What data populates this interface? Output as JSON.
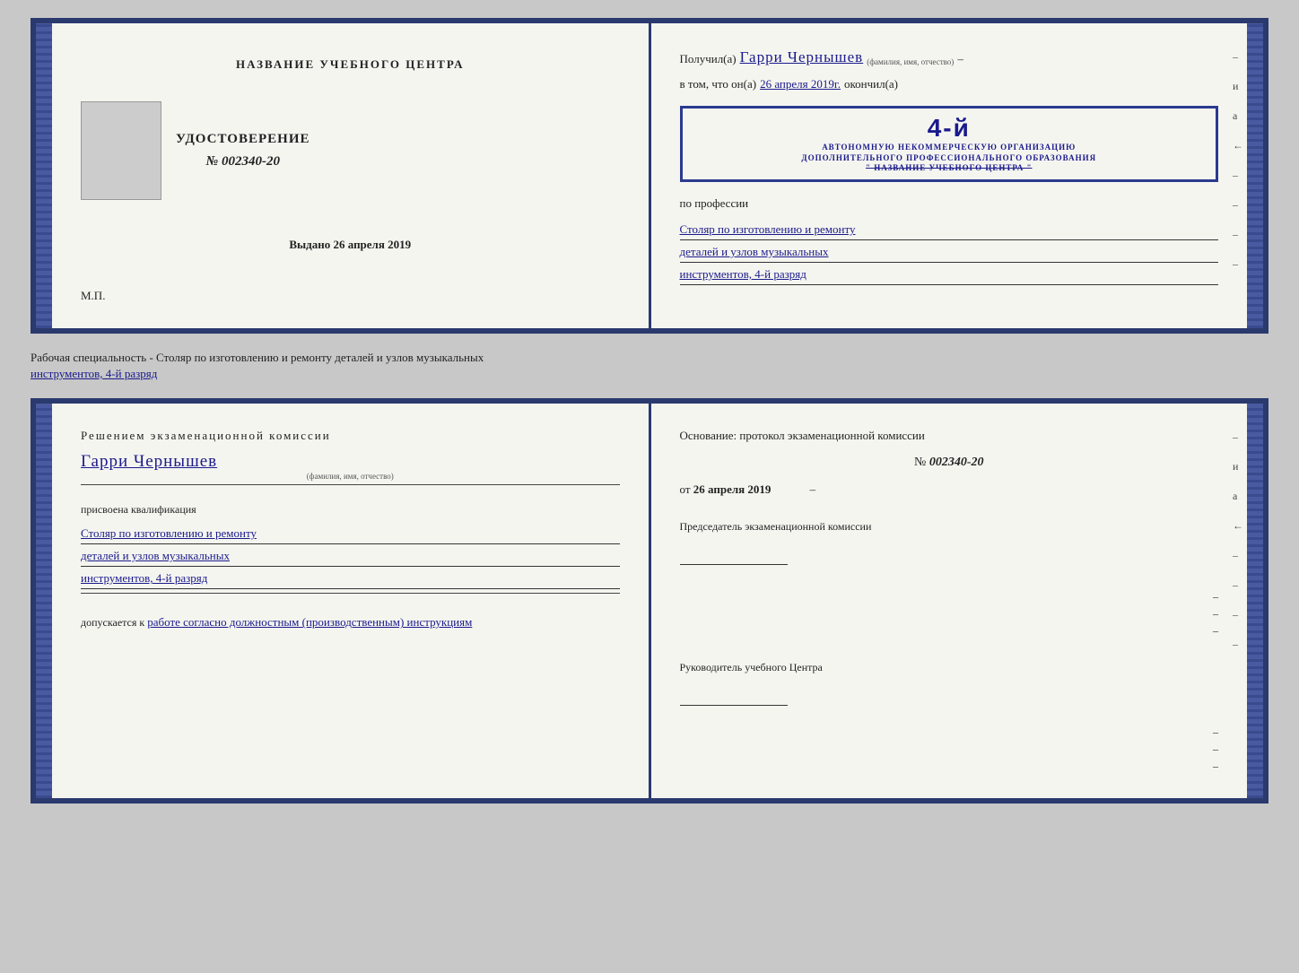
{
  "top_doc": {
    "left": {
      "center_label": "НАЗВАНИЕ УЧЕБНОГО ЦЕНТРА",
      "cert_title": "УДОСТОВЕРЕНИЕ",
      "cert_number_prefix": "№",
      "cert_number": "002340-20",
      "issued_label": "Выдано",
      "issued_date": "26 апреля 2019",
      "mp": "М.П."
    },
    "right": {
      "received_prefix": "Получил(а)",
      "recipient_name": "Гарри Чернышев",
      "name_label": "(фамилия, имя, отчество)",
      "in_that_prefix": "в том, что он(а)",
      "in_that_date": "26 апреля 2019г.",
      "finished_label": "окончил(а)",
      "stamp_big": "4-й",
      "stamp_line1": "АВТОНОМНУЮ НЕКОММЕРЧЕСКУЮ ОРГАНИЗАЦИЮ",
      "stamp_line2": "ДОПОЛНИТЕЛЬНОГО ПРОФЕССИОНАЛЬНОГО ОБРАЗОВАНИЯ",
      "stamp_line3": "\" НАЗВАНИЕ УЧЕБНОГО ЦЕНТРА \"",
      "profession_label": "по профессии",
      "profession_line1": "Столяр по изготовлению и ремонту",
      "profession_line2": "деталей и узлов музыкальных",
      "profession_line3": "инструментов, 4-й разряд"
    }
  },
  "between": {
    "text": "Рабочая специальность - Столяр по изготовлению и ремонту деталей и узлов музыкальных",
    "text2": "инструментов, 4-й разряд"
  },
  "bottom_doc": {
    "left": {
      "decision_title": "Решением  экзаменационной  комиссии",
      "recipient_name": "Гарри Чернышев",
      "name_label": "(фамилия, имя, отчество)",
      "assigned_label": "присвоена квалификация",
      "qualification_line1": "Столяр по изготовлению и ремонту",
      "qualification_line2": "деталей и узлов музыкальных",
      "qualification_line3": "инструментов, 4-й разряд",
      "allowed_prefix": "допускается к",
      "allowed_text": "работе согласно должностным (производственным) инструкциям"
    },
    "right": {
      "protocol_label": "Основание: протокол экзаменационной  комиссии",
      "number_prefix": "№",
      "number": "002340-20",
      "date_prefix": "от",
      "date": "26 апреля 2019",
      "chairman_label": "Председатель экзаменационной комиссии",
      "director_label": "Руководитель учебного Центра"
    }
  },
  "vertical_right": [
    "–",
    "и",
    "а",
    "←",
    "–",
    "–",
    "–",
    "–"
  ]
}
